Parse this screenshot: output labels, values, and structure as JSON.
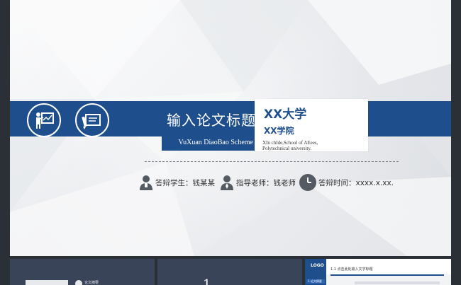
{
  "slide": {
    "title": "输入论文标题",
    "subtitle": "VuXuan DiaoBao Scheme",
    "university": "XX大学",
    "college": "XX学院",
    "school_line1": "XIn chIde,School of AEees,",
    "school_line2": "Polytechnical university.",
    "info": [
      {
        "label": "答辩学生：钱某某",
        "icon": "student-icon"
      },
      {
        "label": "指导老师：钱老师",
        "icon": "teacher-icon"
      },
      {
        "label": "答辩时间：xxxx.x.xx.",
        "icon": "clock-icon"
      }
    ],
    "icons": {
      "presentation": "presentation-board-icon",
      "document": "document-pen-icon"
    },
    "colors": {
      "accent": "#1e4e8c",
      "background": "#f3f4f6",
      "text": "#333333"
    }
  },
  "thumbnails": {
    "t1": {
      "label": "论文摘要"
    },
    "t2": {
      "glyph": "1"
    },
    "t3": {
      "logo": "LOGO",
      "title": "1.1 点击此处输入文字标题",
      "nav": "1 论文摘要"
    }
  }
}
